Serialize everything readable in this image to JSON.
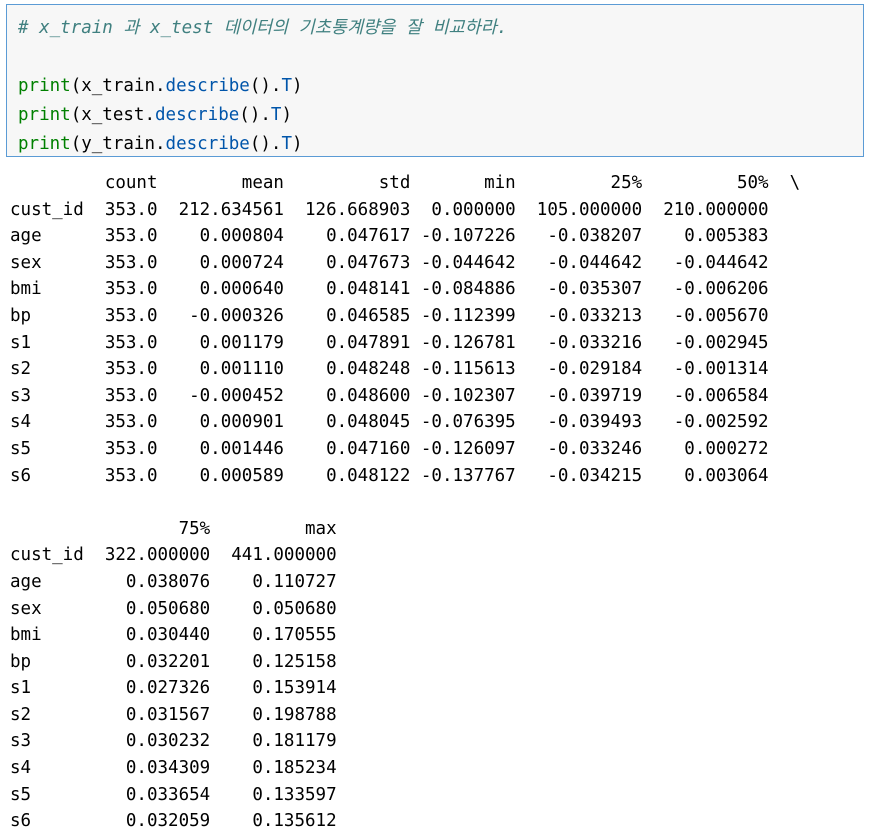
{
  "code_cell": {
    "comment": "# x_train 과 x_test 데이터의 기초통계량을 잘 비교하라.",
    "lines": [
      {
        "func": "print",
        "open": "(",
        "obj": "x_train",
        "dot": ".",
        "method": "describe",
        "call": "().",
        "attr": "T",
        "close": ")"
      },
      {
        "func": "print",
        "open": "(",
        "obj": "x_test",
        "dot": ".",
        "method": "describe",
        "call": "().",
        "attr": "T",
        "close": ")"
      },
      {
        "func": "print",
        "open": "(",
        "obj": "y_train",
        "dot": ".",
        "method": "describe",
        "call": "().",
        "attr": "T",
        "close": ")"
      }
    ]
  },
  "output": {
    "table1": {
      "header": "         count        mean         std       min         25%         50%  \\",
      "rows": [
        "cust_id  353.0  212.634561  126.668903  0.000000  105.000000  210.000000",
        "age      353.0    0.000804    0.047617 -0.107226   -0.038207    0.005383",
        "sex      353.0    0.000724    0.047673 -0.044642   -0.044642   -0.044642",
        "bmi      353.0    0.000640    0.048141 -0.084886   -0.035307   -0.006206",
        "bp       353.0   -0.000326    0.046585 -0.112399   -0.033213   -0.005670",
        "s1       353.0    0.001179    0.047891 -0.126781   -0.033216   -0.002945",
        "s2       353.0    0.001110    0.048248 -0.115613   -0.029184   -0.001314",
        "s3       353.0   -0.000452    0.048600 -0.102307   -0.039719   -0.006584",
        "s4       353.0    0.000901    0.048045 -0.076395   -0.039493   -0.002592",
        "s5       353.0    0.001446    0.047160 -0.126097   -0.033246    0.000272",
        "s6       353.0    0.000589    0.048122 -0.137767   -0.034215    0.003064"
      ]
    },
    "table2": {
      "header": "                75%         max",
      "rows": [
        "cust_id  322.000000  441.000000",
        "age        0.038076    0.110727",
        "sex        0.050680    0.050680",
        "bmi        0.030440    0.170555",
        "bp         0.032201    0.125158",
        "s1         0.027326    0.153914",
        "s2         0.031567    0.198788",
        "s3         0.030232    0.181179",
        "s4         0.034309    0.185234",
        "s5         0.033654    0.133597",
        "s6         0.032059    0.135612"
      ]
    }
  }
}
